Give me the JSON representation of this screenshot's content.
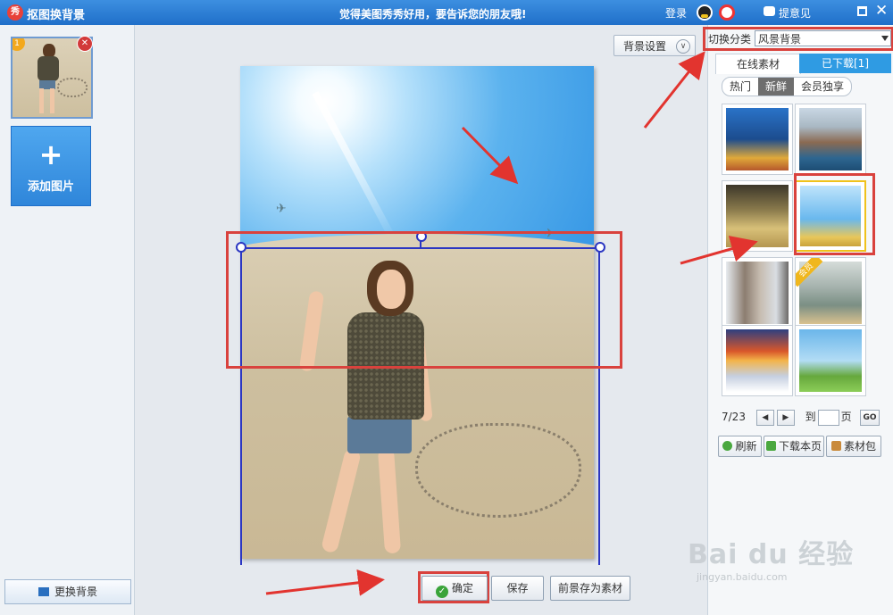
{
  "titlebar": {
    "app_logo": "秀",
    "app_title": "抠图换背景",
    "slogan": "觉得美图秀秀好用，要告诉您的朋友哦!",
    "login": "登录",
    "feedback": "提意见",
    "close": "✕"
  },
  "left": {
    "thumb_badge": "1",
    "thumb_delete": "✕",
    "add_plus": "+",
    "add_label": "添加图片",
    "change_bg": "更换背景"
  },
  "canvas": {
    "bg_settings": "背景设置",
    "bg_settings_chev": "∨",
    "confirm": "确定",
    "confirm_check": "✓",
    "save": "保存",
    "save_as_material": "前景存为素材"
  },
  "right": {
    "switch_label": "切换分类",
    "switch_value": "风景背景",
    "tabs": [
      "在线素材",
      "已下载[1]"
    ],
    "subtabs": [
      "热门",
      "新鲜",
      "会员独享"
    ],
    "active_subtab": "新鲜",
    "vip_label": "会员",
    "pager": {
      "current": "7/23",
      "prev": "◀",
      "next": "▶",
      "goto": "到",
      "page_unit": "页",
      "go": "GO"
    },
    "actions": [
      "刷新",
      "下载本页",
      "素材包"
    ]
  },
  "watermark": {
    "big": "Bai du 经验",
    "small": "jingyan.baidu.com"
  },
  "colors": {
    "titlebar": "#1f6fc9",
    "highlight": "#d9423d",
    "frame": "#2b36c2",
    "tab_active": "#2f9be3"
  }
}
